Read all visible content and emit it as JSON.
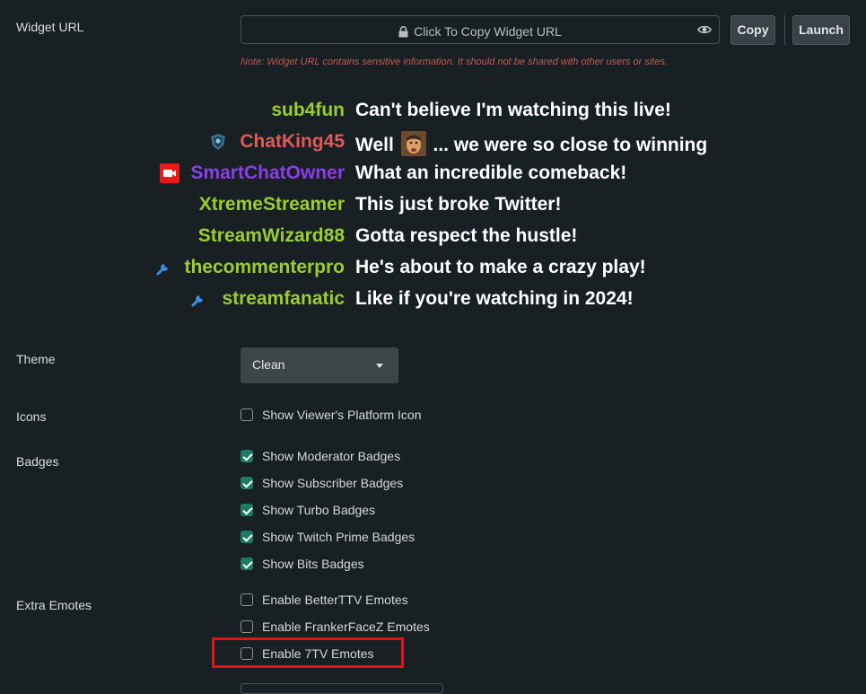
{
  "widget_url": {
    "label": "Widget URL",
    "field_text": "Click To Copy Widget URL",
    "copy_label": "Copy",
    "launch_label": "Launch",
    "note": "Note: Widget URL contains sensitive information. It should not be shared with other users or sites."
  },
  "chat_preview": [
    {
      "user": "sub4fun",
      "color": "#9acd32",
      "badge": "",
      "message": "Can't believe I'm watching this live!"
    },
    {
      "user": "ChatKing45",
      "color": "#e05a5a",
      "badge": "subscriber-shield-icon",
      "message_before": "Well",
      "emote": "face-emote-icon",
      "message": "... we were so close to winning"
    },
    {
      "user": "SmartChatOwner",
      "color": "#8a3ee6",
      "badge": "broadcaster-camera-icon",
      "message": "What an incredible comeback!"
    },
    {
      "user": "XtremeStreamer",
      "color": "#9acd32",
      "badge": "",
      "message": "This just broke Twitter!"
    },
    {
      "user": "StreamWizard88",
      "color": "#9acd32",
      "badge": "",
      "message": "Gotta respect the hustle!"
    },
    {
      "user": "thecommenterpro",
      "color": "#9acd32",
      "badge": "wrench-icon",
      "message": "He's about to make a crazy play!"
    },
    {
      "user": "streamfanatic",
      "color": "#9acd32",
      "badge": "wrench-icon",
      "message": "Like if you're watching in 2024!"
    }
  ],
  "theme": {
    "label": "Theme",
    "value": "Clean"
  },
  "icons": {
    "label": "Icons",
    "options": [
      {
        "label": "Show Viewer's Platform Icon",
        "checked": false
      }
    ]
  },
  "badges": {
    "label": "Badges",
    "options": [
      {
        "label": "Show Moderator Badges",
        "checked": true
      },
      {
        "label": "Show Subscriber Badges",
        "checked": true
      },
      {
        "label": "Show Turbo Badges",
        "checked": true
      },
      {
        "label": "Show Twitch Prime Badges",
        "checked": true
      },
      {
        "label": "Show Bits Badges",
        "checked": true
      }
    ]
  },
  "extra_emotes": {
    "label": "Extra Emotes",
    "options": [
      {
        "label": "Enable BetterTTV Emotes",
        "checked": false
      },
      {
        "label": "Enable FrankerFaceZ Emotes",
        "checked": false
      },
      {
        "label": "Enable 7TV Emotes",
        "checked": false
      }
    ]
  },
  "colors": {
    "background": "#182024",
    "accent_check": "#1d7a63",
    "highlight_box": "#e0141a",
    "note": "#c95552"
  }
}
